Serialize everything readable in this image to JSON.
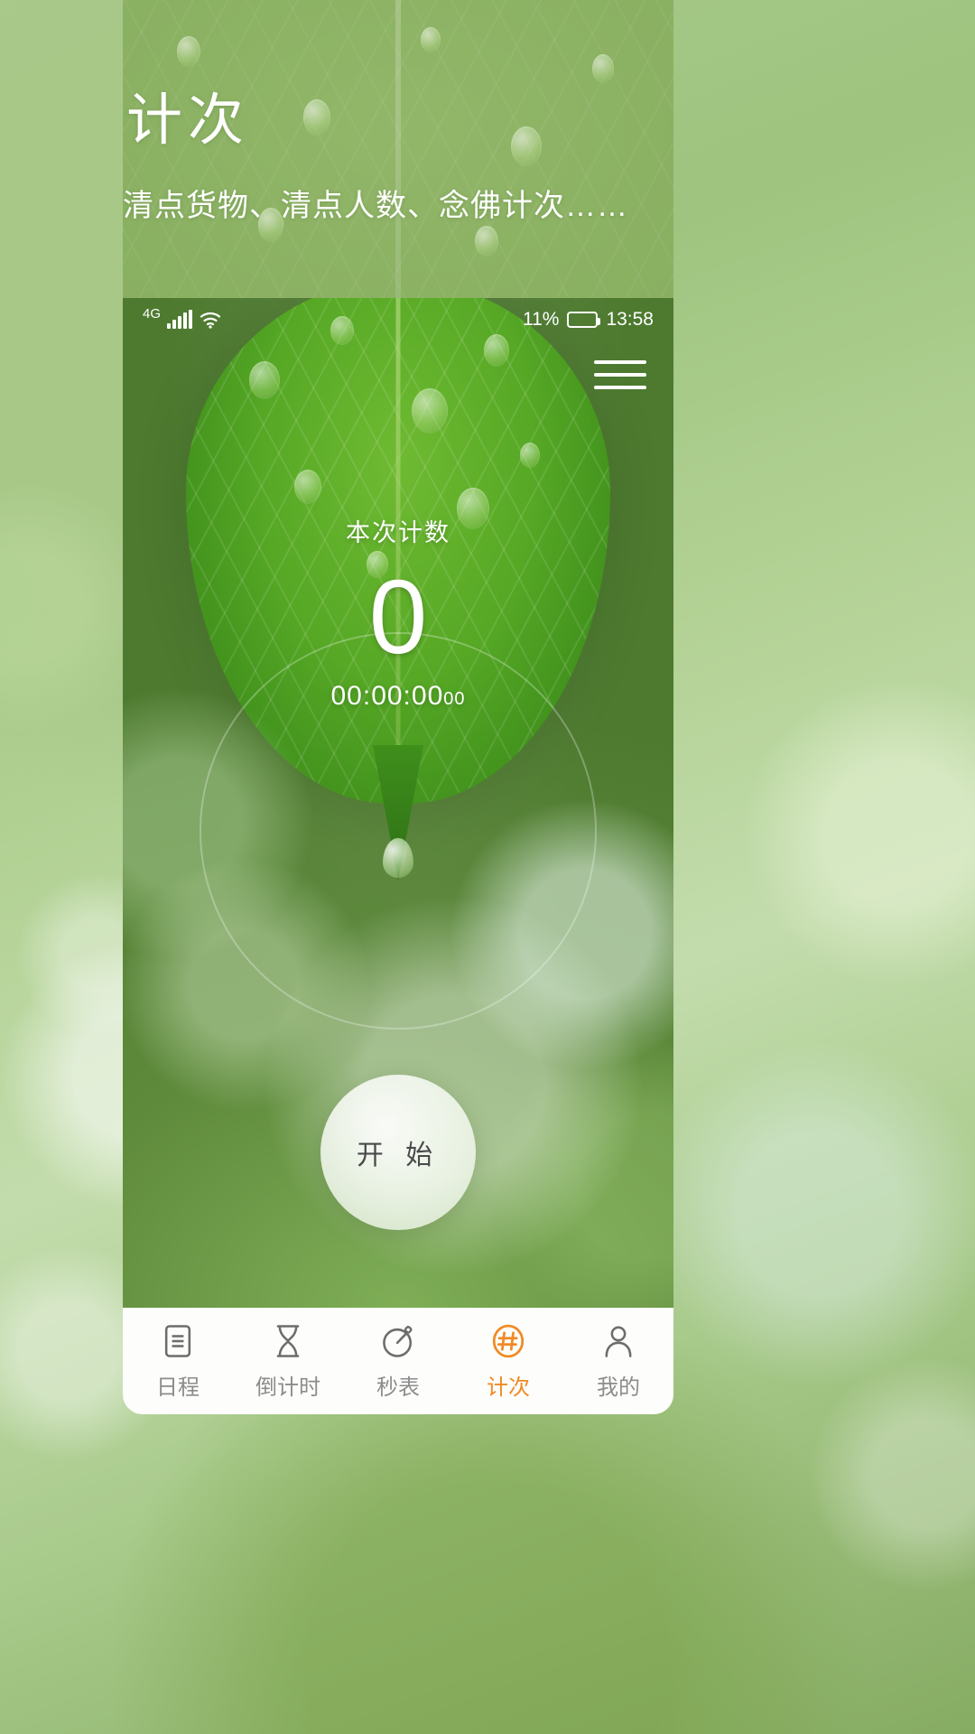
{
  "header": {
    "title": "计次",
    "subtitle": "清点货物、清点人数、念佛计次……"
  },
  "statusbar": {
    "network": "4G",
    "battery_percent": "11%",
    "time": "13:58",
    "signal_icon": "signal-bars-icon",
    "wifi_icon": "wifi-icon",
    "battery_icon": "battery-icon"
  },
  "appbar": {
    "menu_icon": "hamburger-menu-icon"
  },
  "counter": {
    "label": "本次计数",
    "value": "0",
    "time_main": "00:00:00",
    "time_ms": "00"
  },
  "start_button": {
    "label": "开 始"
  },
  "tabbar": {
    "active_color": "#f08a24",
    "inactive_color": "#8c8c8c",
    "items": [
      {
        "label": "日程",
        "icon": "schedule-document-icon",
        "active": false
      },
      {
        "label": "倒计时",
        "icon": "hourglass-countdown-icon",
        "active": false
      },
      {
        "label": "秒表",
        "icon": "stopwatch-icon",
        "active": false
      },
      {
        "label": "计次",
        "icon": "hash-circle-counter-icon",
        "active": true
      },
      {
        "label": "我的",
        "icon": "person-profile-icon",
        "active": false
      }
    ]
  }
}
